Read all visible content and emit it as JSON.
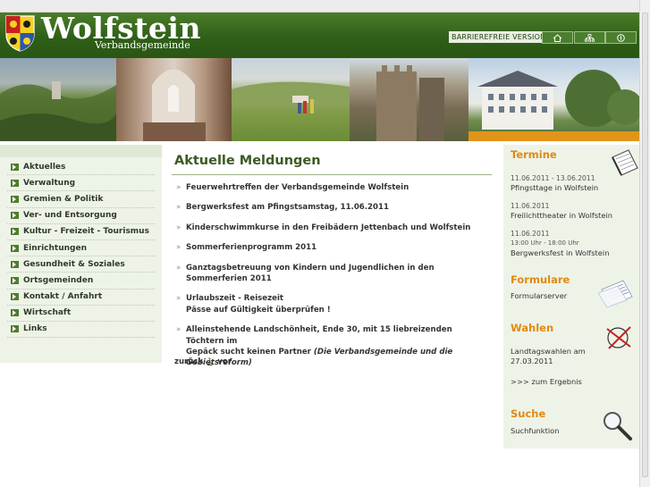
{
  "header": {
    "brand_name": "Wolfstein",
    "brand_sub": "Verbandsgemeinde",
    "barrierefrei": "BARRIEREFREIE VERSION",
    "icons": [
      "home-icon",
      "sitemap-icon",
      "contact-icon"
    ],
    "colors": {
      "header_green": "#2f5f18",
      "accent_orange": "#e08a12",
      "nav_bg": "#eef3e8"
    }
  },
  "nav": {
    "items": [
      "Aktuelles",
      "Verwaltung",
      "Gremien & Politik",
      "Ver- und Entsorgung",
      "Kultur - Freizeit - Tourismus",
      "Einrichtungen",
      "Gesundheit & Soziales",
      "Ortsgemeinden",
      "Kontakt / Anfahrt",
      "Wirtschaft",
      "Links"
    ]
  },
  "main": {
    "title": "Aktuelle Meldungen",
    "news": [
      {
        "text": "Feuerwehrtreffen der Verbandsgemeinde Wolfstein"
      },
      {
        "text": "Bergwerksfest am Pfingstsamstag, 11.06.2011"
      },
      {
        "text": "Kinderschwimmkurse in den Freibädern Jettenbach und Wolfstein"
      },
      {
        "text": "Sommerferienprogramm 2011"
      },
      {
        "text": "Ganztagsbetreuung von Kindern und Jugendlichen in den Sommerferien 2011"
      },
      {
        "line1": "Urlaubszeit - Reisezeit",
        "line2": "Pässe auf Gültigkeit überprüfen !"
      },
      {
        "line1": "Alleinstehende Landschönheit, Ende 30, mit 15 liebreizenden Töchtern im",
        "line2a": "Gepäck sucht keinen Partner ",
        "line2b": "(Die Verbandsgemeinde und die Gebietsreform)"
      }
    ],
    "pager": {
      "back": "zurück",
      "page": "1",
      "next": "vor"
    }
  },
  "right": {
    "termine": {
      "title": "Termine",
      "events": [
        {
          "date": "11.06.2011 - 13.06.2011",
          "time": "",
          "name": "Pfingsttage in Wolfstein"
        },
        {
          "date": "11.06.2011",
          "time": "",
          "name": "Freilichttheater in Wolfstein"
        },
        {
          "date": "11.06.2011",
          "time": "13:00 Uhr - 18:00 Uhr",
          "name": "Bergwerksfest in Wolfstein"
        }
      ]
    },
    "formulare": {
      "title": "Formulare",
      "link": "Formularserver"
    },
    "wahlen": {
      "title": "Wahlen",
      "text1": "Landtagswahlen am",
      "text2": "27.03.2011",
      "link": ">>> zum Ergebnis"
    },
    "suche": {
      "title": "Suche",
      "link": "Suchfunktion"
    }
  }
}
